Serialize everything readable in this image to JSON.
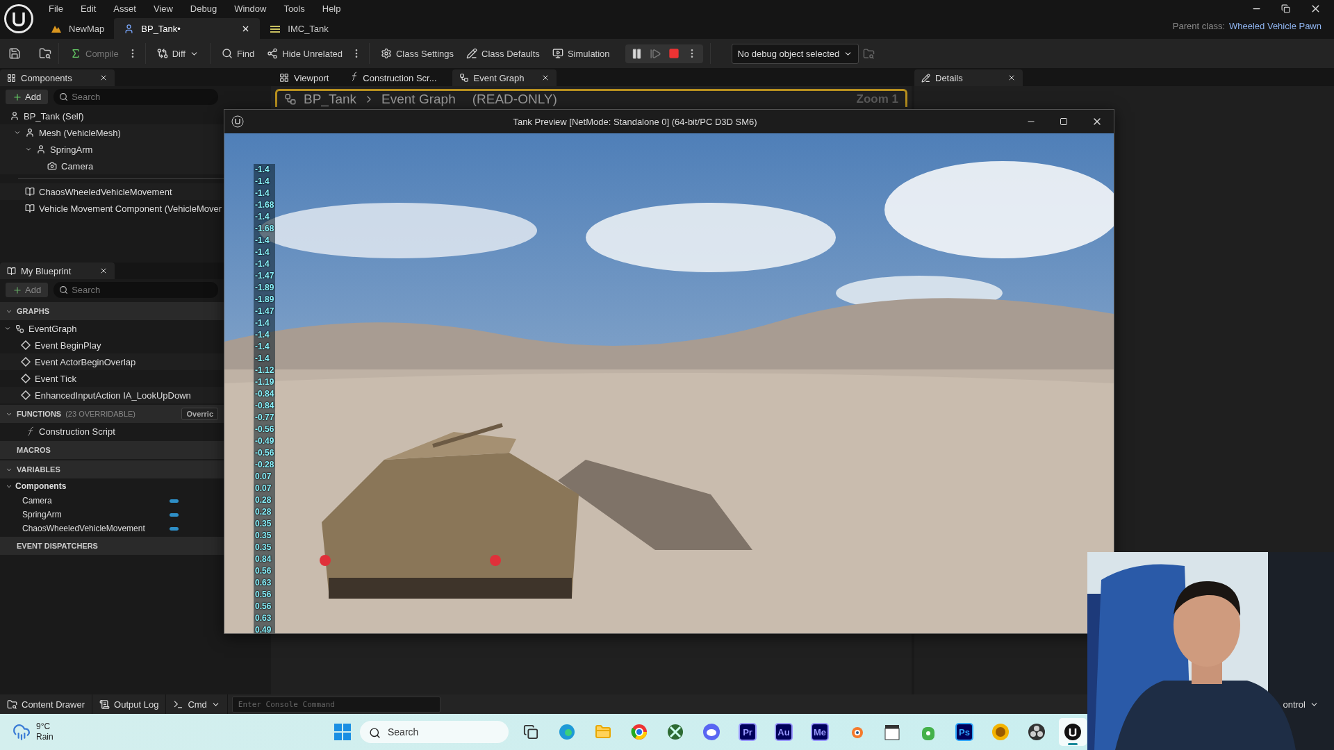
{
  "menu": [
    "File",
    "Edit",
    "Asset",
    "View",
    "Debug",
    "Window",
    "Tools",
    "Help"
  ],
  "doc_tabs": [
    {
      "label": "NewMap",
      "selected": false
    },
    {
      "label": "BP_Tank•",
      "selected": true
    },
    {
      "label": "IMC_Tank",
      "selected": false
    }
  ],
  "parent_class": {
    "label": "Parent class:",
    "value": "Wheeled Vehicle Pawn"
  },
  "toolbar": {
    "buttons": [
      {
        "label": "Compile",
        "disabled": true
      },
      {
        "label": "Diff",
        "disabled": false
      },
      {
        "label": "Find",
        "disabled": false
      },
      {
        "label": "Hide Unrelated",
        "disabled": false
      },
      {
        "label": "Class Settings",
        "disabled": false
      },
      {
        "label": "Class Defaults",
        "disabled": false
      },
      {
        "label": "Simulation",
        "disabled": false
      }
    ],
    "debug_select": "No debug object selected"
  },
  "components_panel": {
    "title": "Components",
    "add": "Add",
    "search_placeholder": "Search",
    "root": "BP_Tank (Self)",
    "tree": [
      {
        "label": "Mesh (VehicleMesh)",
        "expanded": true,
        "children": [
          {
            "label": "SpringArm",
            "expanded": true,
            "children": [
              {
                "label": "Camera",
                "expanded": false
              }
            ]
          }
        ]
      }
    ],
    "other_components": [
      "ChaosWheeledVehicleMovement",
      "Vehicle Movement Component (VehicleMover"
    ]
  },
  "my_blueprint": {
    "title": "My Blueprint",
    "add": "Add",
    "search_placeholder": "Search",
    "sections": [
      {
        "title": "GRAPHS",
        "expanded": true,
        "items": [
          {
            "label": "EventGraph",
            "expanded": true,
            "children": [
              "Event BeginPlay",
              "Event ActorBeginOverlap",
              "Event Tick",
              "EnhancedInputAction IA_LookUpDown"
            ]
          }
        ]
      },
      {
        "title": "FUNCTIONS",
        "note": "(23 OVERRIDABLE)",
        "button": "Overric",
        "expanded": true,
        "items": [
          {
            "label": "Construction Script",
            "expanded": false
          }
        ]
      },
      {
        "title": "MACROS",
        "expanded": false
      },
      {
        "title": "VARIABLES",
        "expanded": true,
        "items": [
          {
            "label": "Components",
            "expanded": true,
            "children": [
              "Camera",
              "SpringArm",
              "ChaosWheeledVehicleMovement"
            ]
          }
        ]
      },
      {
        "title": "EVENT DISPATCHERS",
        "expanded": false
      }
    ]
  },
  "editor_tabs": [
    {
      "label": "Viewport",
      "selected": false
    },
    {
      "label": "Construction Scr...",
      "selected": false
    },
    {
      "label": "Event Graph",
      "selected": true
    }
  ],
  "breadcrumb": {
    "path": [
      "BP_Tank",
      "Event Graph"
    ],
    "mode": "(READ-ONLY)",
    "zoom": "Zoom 1"
  },
  "details_tab": "Details",
  "preview_window": {
    "title": "Tank Preview [NetMode: Standalone 0]  (64-bit/PC D3D SM6)",
    "readings": [
      "-1.4",
      "-1.4",
      "-1.4",
      "-1.68",
      "-1.4",
      "-1.68",
      "-1.4",
      "-1.4",
      "-1.4",
      "-1.47",
      "-1.89",
      "-1.89",
      "-1.47",
      "-1.4",
      "-1.4",
      "-1.4",
      "-1.4",
      "-1.12",
      "-1.19",
      "-0.84",
      "-0.84",
      "-0.77",
      "-0.56",
      "-0.49",
      "-0.56",
      "-0.28",
      "0.07",
      "0.07",
      "0.28",
      "0.28",
      "0.35",
      "0.35",
      "0.35",
      "0.84",
      "0.56",
      "0.63",
      "0.56",
      "0.56",
      "0.63",
      "0.49"
    ]
  },
  "status_bar": {
    "buttons": [
      "Content Drawer",
      "Output Log"
    ],
    "cmd": "Cmd",
    "console_placeholder": "Enter Console Command",
    "right": "ontrol"
  },
  "taskbar": {
    "weather": {
      "temp": "9°C",
      "text": "Rain"
    },
    "search_placeholder": "Search",
    "apps": [
      {
        "kind": "taskview",
        "selected": false
      },
      {
        "kind": "edge",
        "selected": false
      },
      {
        "kind": "explorer",
        "selected": false
      },
      {
        "kind": "chrome",
        "selected": false
      },
      {
        "kind": "xbox",
        "selected": false
      },
      {
        "kind": "discord",
        "selected": false
      },
      {
        "kind": "letter",
        "label": "Pr",
        "color": "#9999ff",
        "selected": false
      },
      {
        "kind": "letter",
        "label": "Au",
        "color": "#9999ff",
        "selected": false
      },
      {
        "kind": "letter",
        "label": "Me",
        "color": "#9999ff",
        "selected": false
      },
      {
        "kind": "blender",
        "selected": false
      },
      {
        "kind": "clapper",
        "selected": false
      },
      {
        "kind": "vpn",
        "selected": false
      },
      {
        "kind": "letter",
        "label": "Ps",
        "color": "#31a8ff",
        "selected": false
      },
      {
        "kind": "coin",
        "selected": false
      },
      {
        "kind": "obs",
        "selected": false
      },
      {
        "kind": "unreal",
        "selected": true
      }
    ]
  }
}
